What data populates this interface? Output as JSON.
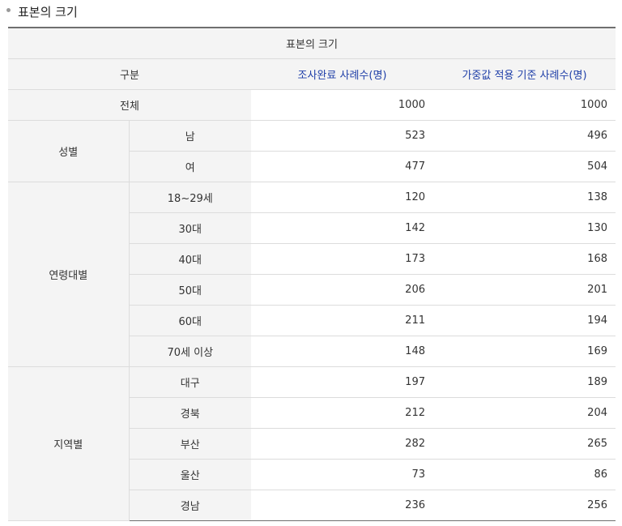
{
  "heading": {
    "title": "표본의 크기"
  },
  "table": {
    "caption": "표본의 크기",
    "headers": {
      "category": "구분",
      "surveyed": "조사완료 사례수(명)",
      "weighted": "가중값 적용 기준 사례수(명)"
    },
    "total": {
      "label": "전체",
      "surveyed": "1000",
      "weighted": "1000"
    },
    "groups": [
      {
        "label": "성별",
        "rows": [
          {
            "label": "남",
            "surveyed": "523",
            "weighted": "496"
          },
          {
            "label": "여",
            "surveyed": "477",
            "weighted": "504"
          }
        ]
      },
      {
        "label": "연령대별",
        "rows": [
          {
            "label": "18~29세",
            "surveyed": "120",
            "weighted": "138"
          },
          {
            "label": "30대",
            "surveyed": "142",
            "weighted": "130"
          },
          {
            "label": "40대",
            "surveyed": "173",
            "weighted": "168"
          },
          {
            "label": "50대",
            "surveyed": "206",
            "weighted": "201"
          },
          {
            "label": "60대",
            "surveyed": "211",
            "weighted": "194"
          },
          {
            "label": "70세 이상",
            "surveyed": "148",
            "weighted": "169"
          }
        ]
      },
      {
        "label": "지역별",
        "rows": [
          {
            "label": "대구",
            "surveyed": "197",
            "weighted": "189"
          },
          {
            "label": "경북",
            "surveyed": "212",
            "weighted": "204"
          },
          {
            "label": "부산",
            "surveyed": "282",
            "weighted": "265"
          },
          {
            "label": "울산",
            "surveyed": "73",
            "weighted": "86"
          },
          {
            "label": "경남",
            "surveyed": "236",
            "weighted": "256"
          }
        ]
      }
    ]
  }
}
